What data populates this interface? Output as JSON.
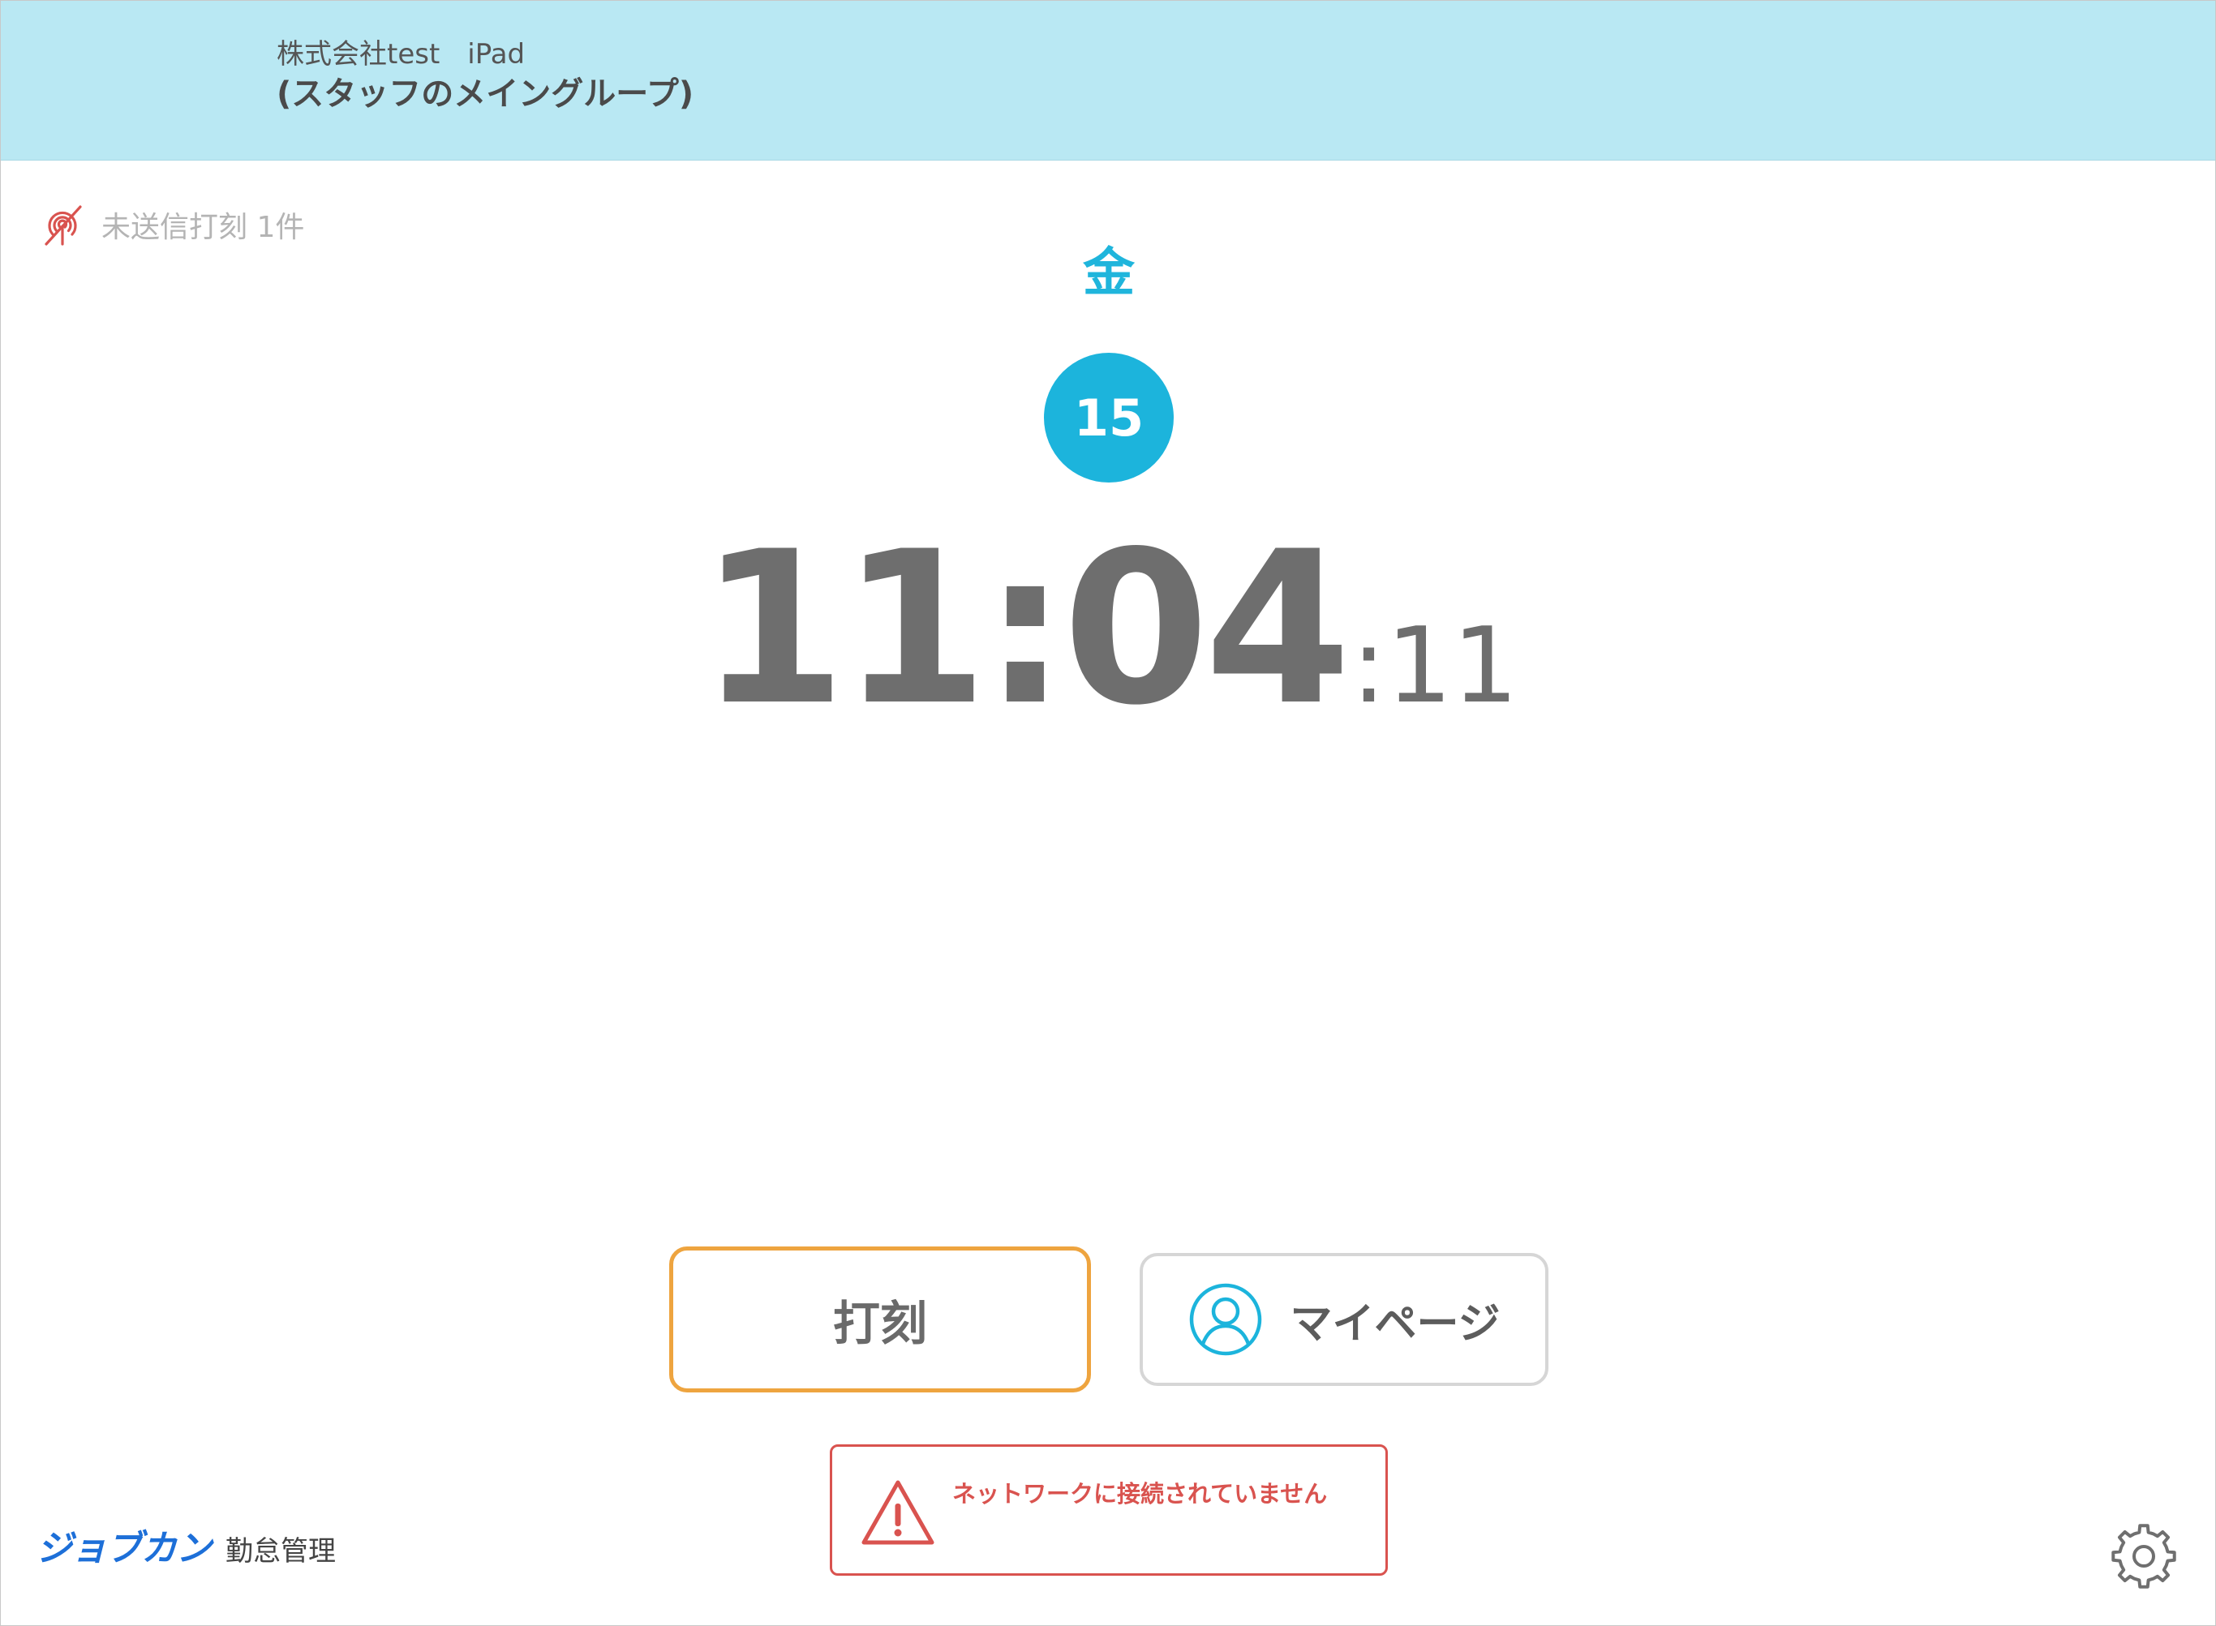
{
  "header": {
    "company": "株式会社test　iPad",
    "group": "(スタッフのメイングループ)"
  },
  "status": {
    "unsent": "未送信打刻 1件"
  },
  "date": {
    "weekday": "金",
    "day": "15"
  },
  "clock": {
    "hours_minutes": "11:04",
    "seconds": ":11"
  },
  "buttons": {
    "punch": "打刻",
    "mypage": "マイページ"
  },
  "warning": {
    "message": "ネットワークに接続されていません"
  },
  "footer": {
    "brand": "ジョブカン",
    "product": "勤怠管理"
  },
  "icons": {
    "unsent": "signal-off-icon",
    "user": "user-circle-icon",
    "warning": "warning-triangle-icon",
    "settings": "gear-icon"
  },
  "colors": {
    "header_bg": "#b9e8f3",
    "accent": "#1cb4dc",
    "punch_border": "#eea43f",
    "error": "#d9534f",
    "brand": "#1d6fd8"
  }
}
